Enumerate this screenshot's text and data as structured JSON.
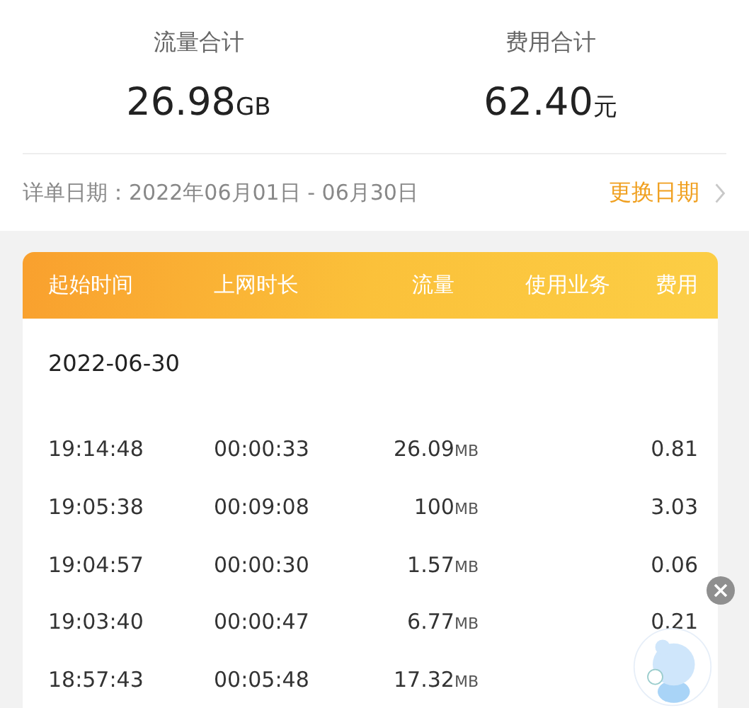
{
  "summary": [
    {
      "label": "流量合计",
      "value": "26.98",
      "unit": "GB"
    },
    {
      "label": "费用合计",
      "value": "62.40",
      "unit": "元"
    }
  ],
  "date_range": {
    "label": "详单日期：2022年06月01日 - 06月30日",
    "action": "更换日期"
  },
  "table": {
    "columns": [
      "起始时间",
      "上网时长",
      "流量",
      "使用业务",
      "费用"
    ],
    "group_date": "2022-06-30",
    "rows": [
      {
        "start": "19:14:48",
        "duration": "00:00:33",
        "flow": "26.09",
        "unit": "MB",
        "fee": "0.81"
      },
      {
        "start": "19:05:38",
        "duration": "00:09:08",
        "flow": "100",
        "unit": "MB",
        "fee": "3.03"
      },
      {
        "start": "19:04:57",
        "duration": "00:00:30",
        "flow": "1.57",
        "unit": "MB",
        "fee": "0.06"
      },
      {
        "start": "19:03:40",
        "duration": "00:00:47",
        "flow": "6.77",
        "unit": "MB",
        "fee": "0.21"
      },
      {
        "start": "18:57:43",
        "duration": "00:05:48",
        "flow": "17.32",
        "unit": "MB"
      }
    ]
  }
}
